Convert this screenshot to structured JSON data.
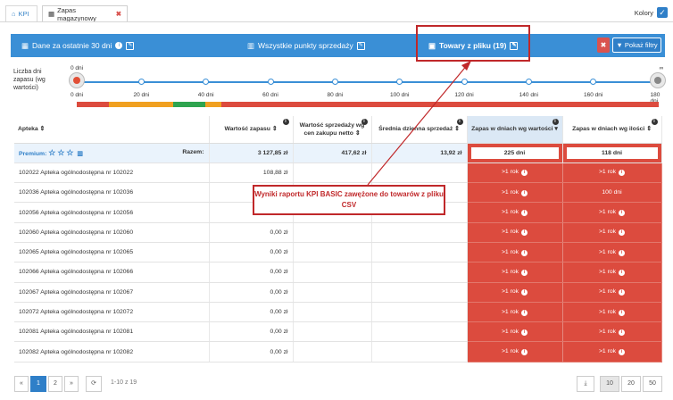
{
  "tabs": [
    {
      "label": "KPI",
      "icon": "home-icon"
    },
    {
      "label": "Zapas magazynowy",
      "icon": "table-icon"
    }
  ],
  "kolory": "Kolory",
  "filterbar": {
    "date_label": "Dane za ostatnie 30 dni",
    "points_label": "Wszystkie punkty sprzedaży",
    "products_label": "Towary z pliku (19)",
    "show_filters": "Pokaż filtry",
    "clear": "✖"
  },
  "slider": {
    "label": "Liczba dni zapasu (wg wartości)",
    "start_value": "0 dni",
    "end_value": "∞",
    "ticks": [
      "0 dni",
      "20 dni",
      "40 dni",
      "60 dni",
      "80 dni",
      "100 dni",
      "120 dni",
      "140 dni",
      "160 dni",
      "180 dni"
    ],
    "range": [
      0,
      180
    ]
  },
  "table": {
    "headers": {
      "apteka": "Apteka",
      "wartosc": "Wartość zapasu",
      "wartosc_sprzedazy": "Wartość sprzedaży wg cen zakupu netto",
      "srednia": "Średnia dzienna sprzedaż",
      "zapas_wartosc": "Zapas w dniach wg wartości",
      "zapas_ilosc": "Zapas w dniach wg ilości"
    },
    "premium": {
      "label": "Premium:",
      "razem": "Razem:",
      "wartosc": "3 127,85 zł",
      "sprzedaz": "417,62 zł",
      "srednia": "13,92 zł",
      "zapas_wartosc": "225 dni",
      "zapas_ilosc": "118 dni"
    },
    "rows": [
      {
        "name": "102022 Apteka ogólnodostępna nr 102022",
        "wartosc": "108,88 zł",
        "zw": ">1 rok",
        "zi": ">1 rok"
      },
      {
        "name": "102036 Apteka ogólnodostępna nr 102036",
        "wartosc": "",
        "zw": ">1 rok",
        "zi": "100 dni"
      },
      {
        "name": "102056 Apteka ogólnodostępna nr 102056",
        "wartosc": "",
        "zw": ">1 rok",
        "zi": ">1 rok"
      },
      {
        "name": "102060 Apteka ogólnodostępna nr 102060",
        "wartosc": "0,00 zł",
        "zw": ">1 rok",
        "zi": ">1 rok"
      },
      {
        "name": "102065 Apteka ogólnodostępna nr 102065",
        "wartosc": "0,00 zł",
        "zw": ">1 rok",
        "zi": ">1 rok"
      },
      {
        "name": "102066 Apteka ogólnodostępna nr 102066",
        "wartosc": "0,00 zł",
        "zw": ">1 rok",
        "zi": ">1 rok"
      },
      {
        "name": "102067 Apteka ogólnodostępna nr 102067",
        "wartosc": "0,00 zł",
        "zw": ">1 rok",
        "zi": ">1 rok"
      },
      {
        "name": "102072 Apteka ogólnodostępna nr 102072",
        "wartosc": "0,00 zł",
        "zw": ">1 rok",
        "zi": ">1 rok"
      },
      {
        "name": "102081 Apteka ogólnodostępna nr 102081",
        "wartosc": "0,00 zł",
        "zw": ">1 rok",
        "zi": ">1 rok"
      },
      {
        "name": "102082 Apteka ogólnodostępna nr 102082",
        "wartosc": "0,00 zł",
        "zw": ">1 rok",
        "zi": ">1 rok"
      }
    ]
  },
  "callout": "Wyniki raportu KPI BASIC zawężone do towarów z pliku CSV",
  "pagination": {
    "prev": "«",
    "next": "»",
    "pages": [
      "1",
      "2"
    ],
    "info": "1-10 z 19",
    "sizes": [
      "10",
      "20",
      "50"
    ]
  },
  "colors": {
    "accent": "#3a8fd6",
    "danger": "#dc4b3e",
    "annotation": "#c0282a"
  }
}
